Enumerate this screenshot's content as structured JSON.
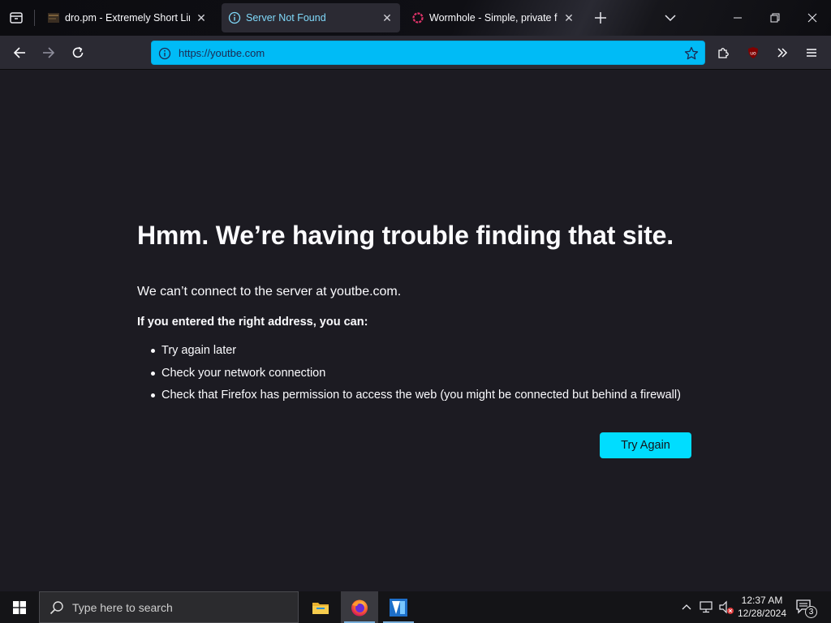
{
  "tabs": [
    {
      "title": "dro.pm - Extremely Short Links",
      "favicon": "dro-pm-favicon",
      "active": false
    },
    {
      "title": "Server Not Found",
      "favicon": "info-icon",
      "active": true
    },
    {
      "title": "Wormhole - Simple, private file",
      "favicon": "wormhole-favicon",
      "active": false
    }
  ],
  "urlbar": {
    "url": "https://youtbe.com"
  },
  "error_page": {
    "title": "Hmm. We’re having trouble finding that site.",
    "description": "We can’t connect to the server at youtbe.com.",
    "subheading": "If you entered the right address, you can:",
    "suggestions": [
      "Try again later",
      "Check your network connection",
      "Check that Firefox has permission to access the web (you might be connected but behind a firewall)"
    ],
    "try_again_label": "Try Again"
  },
  "taskbar": {
    "search_placeholder": "Type here to search",
    "clock_time": "12:37 AM",
    "clock_date": "12/28/2024",
    "notification_count": "3"
  },
  "colors": {
    "accent": "#00ddff",
    "urlbar_bg": "#00bbf6",
    "page_bg": "#1c1b22",
    "toolbar_bg": "#2b2a33"
  }
}
